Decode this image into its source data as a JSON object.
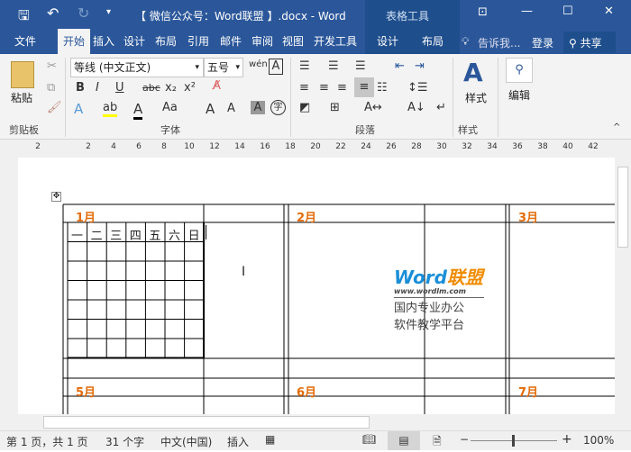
{
  "titlebar": {
    "title": "【 微信公众号：Word联盟 】.docx - Word",
    "context_tab_group": "表格工具"
  },
  "tabs": [
    {
      "label": "文件"
    },
    {
      "label": "开始"
    },
    {
      "label": "插入"
    },
    {
      "label": "设计"
    },
    {
      "label": "布局"
    },
    {
      "label": "引用"
    },
    {
      "label": "邮件"
    },
    {
      "label": "审阅"
    },
    {
      "label": "视图"
    },
    {
      "label": "开发工具"
    },
    {
      "label": "设计"
    },
    {
      "label": "布局"
    }
  ],
  "tell_me": "告诉我...",
  "signin": "登录",
  "share": "共享",
  "ribbon": {
    "paste": "粘贴",
    "font_name": "等线 (中文正文)",
    "font_size": "五号",
    "styles": "样式",
    "edit": "编辑",
    "groups": [
      "剪贴板",
      "字体",
      "段落",
      "样式"
    ]
  },
  "ruler": [
    "2",
    "2",
    "4",
    "6",
    "8",
    "10",
    "12",
    "14",
    "16",
    "18",
    "20",
    "22",
    "24",
    "26",
    "28",
    "30",
    "32",
    "34",
    "36",
    "38",
    "40",
    "42"
  ],
  "months": [
    "1月",
    "2月",
    "3月",
    "5月",
    "6月",
    "7月"
  ],
  "weekdays": [
    "一",
    "二",
    "三",
    "四",
    "五",
    "六",
    "日"
  ],
  "watermark": {
    "brand_a": "Word",
    "brand_b": "联盟",
    "url": "www.wordlm.com",
    "line1": "国内专业办公",
    "line2": "软件教学平台"
  },
  "status": {
    "page": "第 1 页，共 1 页",
    "words": "31 个字",
    "lang": "中文(中国)",
    "mode": "插入",
    "zoom": "100%"
  },
  "colors": {
    "brand": "#2b579a",
    "month": "#e36c09"
  }
}
